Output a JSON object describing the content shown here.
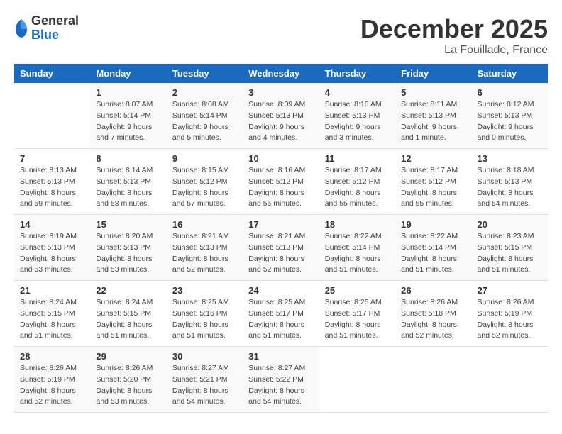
{
  "logo": {
    "general": "General",
    "blue": "Blue"
  },
  "title": "December 2025",
  "location": "La Fouillade, France",
  "days_of_week": [
    "Sunday",
    "Monday",
    "Tuesday",
    "Wednesday",
    "Thursday",
    "Friday",
    "Saturday"
  ],
  "weeks": [
    [
      {
        "day": "",
        "info": ""
      },
      {
        "day": "1",
        "info": "Sunrise: 8:07 AM\nSunset: 5:14 PM\nDaylight: 9 hours\nand 7 minutes."
      },
      {
        "day": "2",
        "info": "Sunrise: 8:08 AM\nSunset: 5:14 PM\nDaylight: 9 hours\nand 5 minutes."
      },
      {
        "day": "3",
        "info": "Sunrise: 8:09 AM\nSunset: 5:13 PM\nDaylight: 9 hours\nand 4 minutes."
      },
      {
        "day": "4",
        "info": "Sunrise: 8:10 AM\nSunset: 5:13 PM\nDaylight: 9 hours\nand 3 minutes."
      },
      {
        "day": "5",
        "info": "Sunrise: 8:11 AM\nSunset: 5:13 PM\nDaylight: 9 hours\nand 1 minute."
      },
      {
        "day": "6",
        "info": "Sunrise: 8:12 AM\nSunset: 5:13 PM\nDaylight: 9 hours\nand 0 minutes."
      }
    ],
    [
      {
        "day": "7",
        "info": "Sunrise: 8:13 AM\nSunset: 5:13 PM\nDaylight: 8 hours\nand 59 minutes."
      },
      {
        "day": "8",
        "info": "Sunrise: 8:14 AM\nSunset: 5:13 PM\nDaylight: 8 hours\nand 58 minutes."
      },
      {
        "day": "9",
        "info": "Sunrise: 8:15 AM\nSunset: 5:12 PM\nDaylight: 8 hours\nand 57 minutes."
      },
      {
        "day": "10",
        "info": "Sunrise: 8:16 AM\nSunset: 5:12 PM\nDaylight: 8 hours\nand 56 minutes."
      },
      {
        "day": "11",
        "info": "Sunrise: 8:17 AM\nSunset: 5:12 PM\nDaylight: 8 hours\nand 55 minutes."
      },
      {
        "day": "12",
        "info": "Sunrise: 8:17 AM\nSunset: 5:12 PM\nDaylight: 8 hours\nand 55 minutes."
      },
      {
        "day": "13",
        "info": "Sunrise: 8:18 AM\nSunset: 5:13 PM\nDaylight: 8 hours\nand 54 minutes."
      }
    ],
    [
      {
        "day": "14",
        "info": "Sunrise: 8:19 AM\nSunset: 5:13 PM\nDaylight: 8 hours\nand 53 minutes."
      },
      {
        "day": "15",
        "info": "Sunrise: 8:20 AM\nSunset: 5:13 PM\nDaylight: 8 hours\nand 53 minutes."
      },
      {
        "day": "16",
        "info": "Sunrise: 8:21 AM\nSunset: 5:13 PM\nDaylight: 8 hours\nand 52 minutes."
      },
      {
        "day": "17",
        "info": "Sunrise: 8:21 AM\nSunset: 5:13 PM\nDaylight: 8 hours\nand 52 minutes."
      },
      {
        "day": "18",
        "info": "Sunrise: 8:22 AM\nSunset: 5:14 PM\nDaylight: 8 hours\nand 51 minutes."
      },
      {
        "day": "19",
        "info": "Sunrise: 8:22 AM\nSunset: 5:14 PM\nDaylight: 8 hours\nand 51 minutes."
      },
      {
        "day": "20",
        "info": "Sunrise: 8:23 AM\nSunset: 5:15 PM\nDaylight: 8 hours\nand 51 minutes."
      }
    ],
    [
      {
        "day": "21",
        "info": "Sunrise: 8:24 AM\nSunset: 5:15 PM\nDaylight: 8 hours\nand 51 minutes."
      },
      {
        "day": "22",
        "info": "Sunrise: 8:24 AM\nSunset: 5:15 PM\nDaylight: 8 hours\nand 51 minutes."
      },
      {
        "day": "23",
        "info": "Sunrise: 8:25 AM\nSunset: 5:16 PM\nDaylight: 8 hours\nand 51 minutes."
      },
      {
        "day": "24",
        "info": "Sunrise: 8:25 AM\nSunset: 5:17 PM\nDaylight: 8 hours\nand 51 minutes."
      },
      {
        "day": "25",
        "info": "Sunrise: 8:25 AM\nSunset: 5:17 PM\nDaylight: 8 hours\nand 51 minutes."
      },
      {
        "day": "26",
        "info": "Sunrise: 8:26 AM\nSunset: 5:18 PM\nDaylight: 8 hours\nand 52 minutes."
      },
      {
        "day": "27",
        "info": "Sunrise: 8:26 AM\nSunset: 5:19 PM\nDaylight: 8 hours\nand 52 minutes."
      }
    ],
    [
      {
        "day": "28",
        "info": "Sunrise: 8:26 AM\nSunset: 5:19 PM\nDaylight: 8 hours\nand 52 minutes."
      },
      {
        "day": "29",
        "info": "Sunrise: 8:26 AM\nSunset: 5:20 PM\nDaylight: 8 hours\nand 53 minutes."
      },
      {
        "day": "30",
        "info": "Sunrise: 8:27 AM\nSunset: 5:21 PM\nDaylight: 8 hours\nand 54 minutes."
      },
      {
        "day": "31",
        "info": "Sunrise: 8:27 AM\nSunset: 5:22 PM\nDaylight: 8 hours\nand 54 minutes."
      },
      {
        "day": "",
        "info": ""
      },
      {
        "day": "",
        "info": ""
      },
      {
        "day": "",
        "info": ""
      }
    ]
  ]
}
